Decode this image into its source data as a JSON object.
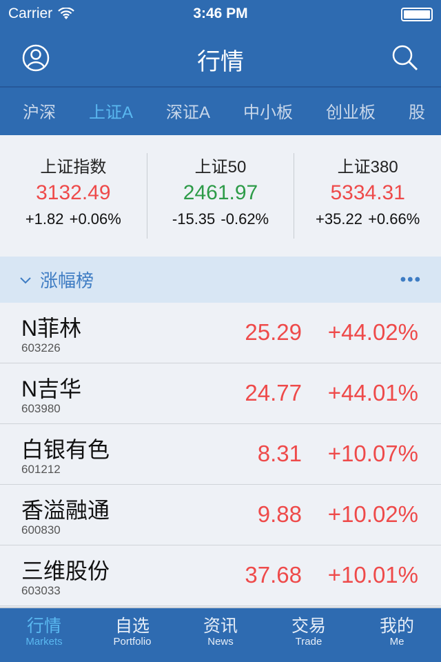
{
  "status": {
    "carrier": "Carrier",
    "time": "3:46 PM"
  },
  "nav": {
    "title": "行情",
    "left_icon": "user-icon",
    "right_icon": "search-icon"
  },
  "tabs": [
    {
      "label": "沪深"
    },
    {
      "label": "上证A",
      "active": true
    },
    {
      "label": "深证A"
    },
    {
      "label": "中小板"
    },
    {
      "label": "创业板"
    },
    {
      "label": "股"
    }
  ],
  "indices": [
    {
      "name": "上证指数",
      "value": "3132.49",
      "change": "+1.82",
      "pct": "+0.06%",
      "dir": "up"
    },
    {
      "name": "上证50",
      "value": "2461.97",
      "change": "-15.35",
      "pct": "-0.62%",
      "dir": "down"
    },
    {
      "name": "上证380",
      "value": "5334.31",
      "change": "+35.22",
      "pct": "+0.66%",
      "dir": "up"
    }
  ],
  "section": {
    "label": "涨幅榜",
    "more": "•••"
  },
  "stocks": [
    {
      "name": "N菲林",
      "code": "603226",
      "price": "25.29",
      "pct": "+44.02%"
    },
    {
      "name": "N吉华",
      "code": "603980",
      "price": "24.77",
      "pct": "+44.01%"
    },
    {
      "name": "白银有色",
      "code": "601212",
      "price": "8.31",
      "pct": "+10.07%"
    },
    {
      "name": "香溢融通",
      "code": "600830",
      "price": "9.88",
      "pct": "+10.02%"
    },
    {
      "name": "三维股份",
      "code": "603033",
      "price": "37.68",
      "pct": "+10.01%"
    }
  ],
  "tabbar": [
    {
      "zh": "行情",
      "en": "Markets",
      "active": true
    },
    {
      "zh": "自选",
      "en": "Portfolio"
    },
    {
      "zh": "资讯",
      "en": "News"
    },
    {
      "zh": "交易",
      "en": "Trade"
    },
    {
      "zh": "我的",
      "en": "Me"
    }
  ],
  "colors": {
    "primary": "#2e6bb1",
    "active": "#5ab8f0",
    "up": "#ee4a4a",
    "down": "#2d9b48"
  }
}
